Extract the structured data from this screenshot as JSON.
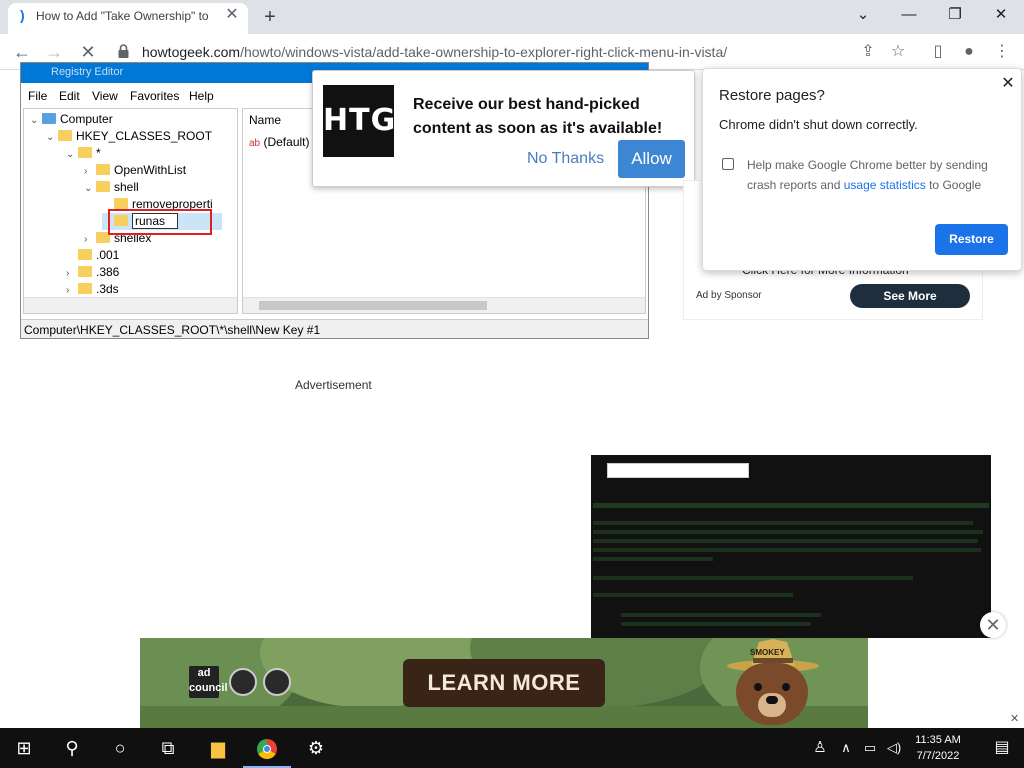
{
  "browser": {
    "tab_title": "How to Add \"Take Ownership\" to",
    "tab_favicon": "htg-favicon",
    "url_host": "howtogeek.com",
    "url_path": "/howto/windows-vista/add-take-ownership-to-explorer-right-click-menu-in-vista/"
  },
  "regedit": {
    "title": "Registry Editor",
    "menu": [
      "File",
      "Edit",
      "View",
      "Favorites",
      "Help"
    ],
    "tree": [
      {
        "label": "Computer"
      },
      {
        "label": "HKEY_CLASSES_ROOT"
      },
      {
        "label": "*"
      },
      {
        "label": "OpenWithList"
      },
      {
        "label": "shell"
      },
      {
        "label": "removeproperti"
      },
      {
        "label": "runas"
      },
      {
        "label": "shellex"
      },
      {
        "label": ".001"
      },
      {
        "label": ".386"
      },
      {
        "label": ".3ds"
      }
    ],
    "list_header": "Name",
    "list_default": "(Default)",
    "status": "Computer\\HKEY_CLASSES_ROOT\\*\\shell\\New Key #1"
  },
  "notify": {
    "logo": "HTG",
    "message": "Receive our best hand-picked content as soon as it's available!",
    "no_thanks": "No Thanks",
    "allow": "Allow"
  },
  "restore_popup": {
    "title": "Restore pages?",
    "message": "Chrome didn't shut down correctly.",
    "check_text_pre": "Help make Google Chrome better by sending crash reports and ",
    "check_link": "usage statistics",
    "check_text_post": " to Google",
    "restore_button": "Restore"
  },
  "sponsor_ad": {
    "click_here": "Click Here for More Information",
    "ad_by": "Ad by Sponsor",
    "see_more": "See More"
  },
  "advertisement_label": "Advertisement",
  "banner": {
    "ad_council": "ad\ncouncil",
    "learn_more": "LEARN MORE",
    "smokey": "SMOKEY"
  },
  "taskbar": {
    "time": "11:35 AM",
    "date": "7/7/2022"
  },
  "colors": {
    "accent": "#1a73e8",
    "allow": "#3c86d3",
    "see_more": "#1f2e3d",
    "regedit_title": "#0078d7"
  }
}
